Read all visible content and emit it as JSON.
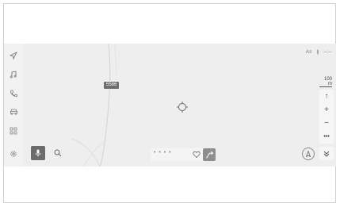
{
  "map": {
    "route_label": "5586",
    "scale_label": "100 m"
  },
  "status": {
    "audio": "A≡",
    "bluetooth": "∦",
    "time": "--:--"
  },
  "right_panel": {
    "heading_up": "↑",
    "zoom_in": "+",
    "zoom_out": "−",
    "more": "•••"
  },
  "bottom": {
    "dots": "• • • •"
  },
  "sidebar": {
    "items": [
      "navigation-icon",
      "music-icon",
      "phone-icon",
      "car-icon",
      "apps-icon",
      "settings-icon"
    ]
  }
}
